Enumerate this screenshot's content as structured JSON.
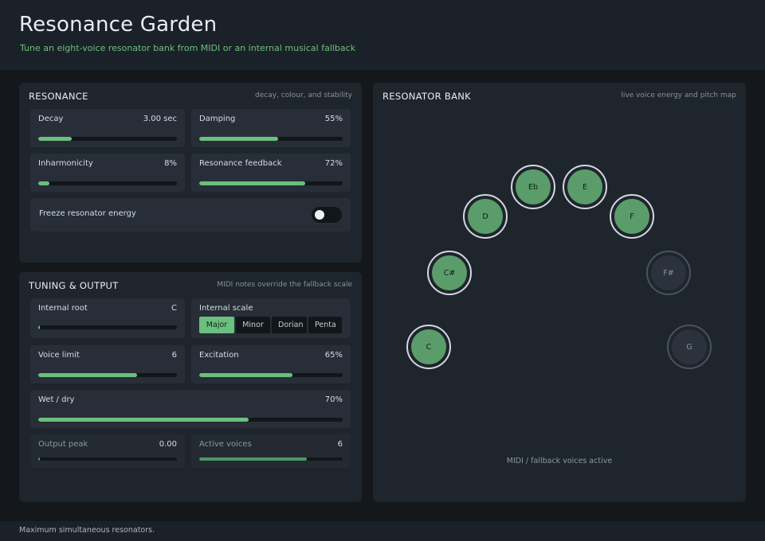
{
  "app": {
    "title": "Resonance Garden",
    "subtitle": "Tune an eight-voice resonator bank from MIDI or an internal musical fallback"
  },
  "resonance": {
    "title": "RESONANCE",
    "hint": "decay, colour, and stability",
    "decay": {
      "label": "Decay",
      "value": "3.00 sec",
      "level": 0.24
    },
    "damping": {
      "label": "Damping",
      "value": "55%",
      "level": 0.55
    },
    "inharmonicity": {
      "label": "Inharmonicity",
      "value": "8%",
      "level": 0.08
    },
    "feedback": {
      "label": "Resonance feedback",
      "value": "72%",
      "level": 0.74
    },
    "freeze": {
      "label": "Freeze resonator energy",
      "on": false
    }
  },
  "tuning": {
    "title": "TUNING & OUTPUT",
    "hint": "MIDI notes override the fallback scale",
    "root": {
      "label": "Internal root",
      "value": "C",
      "level": 0.01
    },
    "scale": {
      "label": "Internal scale",
      "options": [
        "Major",
        "Minor",
        "Dorian",
        "Penta"
      ],
      "selected": "Major"
    },
    "voice_limit": {
      "label": "Voice limit",
      "value": "6",
      "level": 0.71
    },
    "excitation": {
      "label": "Excitation",
      "value": "65%",
      "level": 0.65
    },
    "wet_dry": {
      "label": "Wet / dry",
      "value": "70%",
      "level": 0.69
    },
    "output_peak": {
      "label": "Output peak",
      "value": "0.00",
      "level": 0.01
    },
    "active_voices": {
      "label": "Active voices",
      "value": "6",
      "level": 0.75
    }
  },
  "bank": {
    "title": "RESONATOR BANK",
    "hint": "live voice energy and pitch map",
    "status": "MIDI / fallback voices active",
    "voices": [
      {
        "note": "C",
        "active": true
      },
      {
        "note": "C#",
        "active": true
      },
      {
        "note": "D",
        "active": true
      },
      {
        "note": "Eb",
        "active": true
      },
      {
        "note": "E",
        "active": true
      },
      {
        "note": "F",
        "active": true
      },
      {
        "note": "F#",
        "active": false
      },
      {
        "note": "G",
        "active": false
      }
    ]
  },
  "footer": {
    "text": "Maximum simultaneous resonators."
  },
  "colors": {
    "accent": "#6cbf7e",
    "panel": "#1f252d",
    "card": "#272e37",
    "background": "#14181d"
  }
}
